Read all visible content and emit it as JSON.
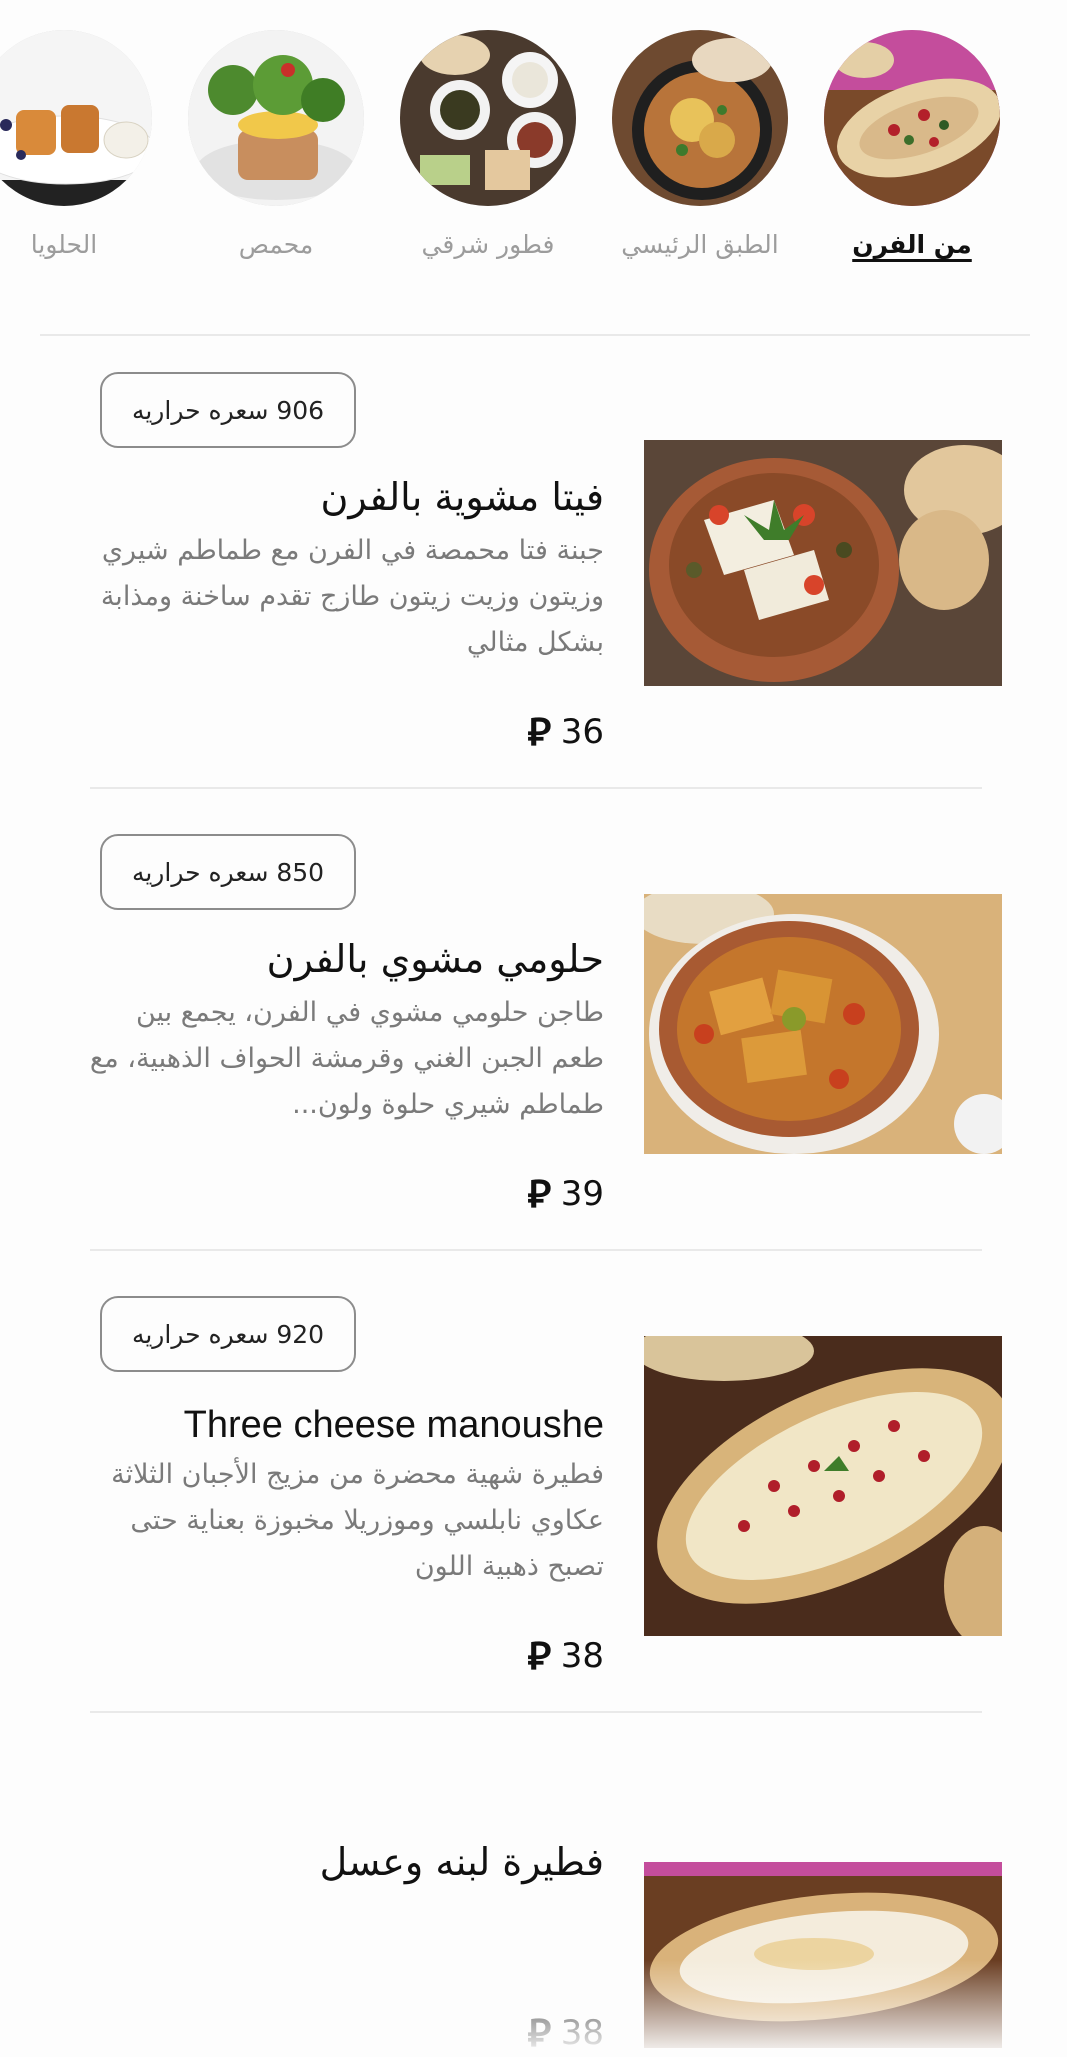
{
  "categories": [
    {
      "label": "من الفرن",
      "active": true
    },
    {
      "label": "الطبق الرئيسي",
      "active": false
    },
    {
      "label": "فطور شرقي",
      "active": false
    },
    {
      "label": "محمص",
      "active": false
    },
    {
      "label": "الحلويا",
      "active": false
    }
  ],
  "currency_symbol": "⃁",
  "items": [
    {
      "calories": "906 سعره حراريه",
      "name": "فيتا مشوية بالفرن",
      "description": "جبنة فتا محمصة في الفرن مع طماطم شيري وزيتون وزيت زيتون طازج تقدم ساخنة ومذابة بشكل مثالي",
      "price": "36",
      "photo_icon": "baked-feta-dish"
    },
    {
      "calories": "850 سعره حراريه",
      "name": "حلومي مشوي بالفرن",
      "description": "طاجن حلومي مشوي في الفرن، يجمع بين طعم الجبن الغني وقرمشة الحواف الذهبية، مع طماطم شيري حلوة ولون...",
      "price": "39",
      "photo_icon": "baked-halloumi-dish"
    },
    {
      "calories": "920 سعره حراريه",
      "name": "Three cheese manoushe",
      "description": "فطيرة شهية محضرة من مزيج الأجبان الثلاثة عكاوي نابلسي وموزريلا مخبوزة بعناية حتى تصبح ذهبية اللون",
      "price": "38",
      "photo_icon": "cheese-manoushe"
    },
    {
      "calories": "",
      "name": "فطيرة لبنه وعسل",
      "description": "",
      "price": "38",
      "photo_icon": "labneh-honey-pie"
    }
  ]
}
